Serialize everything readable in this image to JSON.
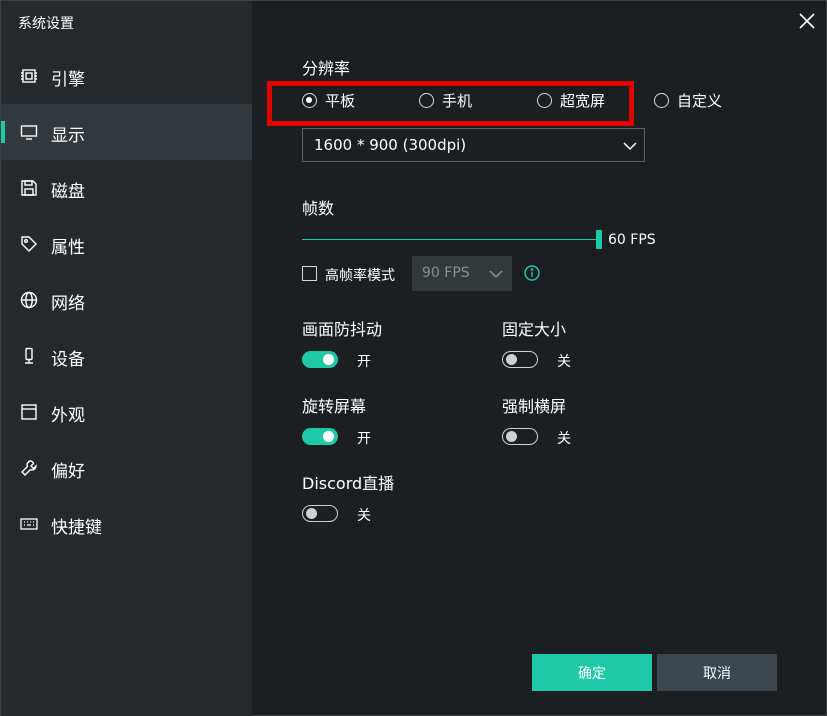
{
  "window": {
    "title": "系统设置"
  },
  "sidebar": {
    "items": [
      {
        "label": "引擎",
        "icon": "chip-icon"
      },
      {
        "label": "显示",
        "icon": "monitor-icon",
        "active": true
      },
      {
        "label": "磁盘",
        "icon": "save-disk-icon"
      },
      {
        "label": "属性",
        "icon": "tag-icon"
      },
      {
        "label": "网络",
        "icon": "globe-icon"
      },
      {
        "label": "设备",
        "icon": "device-icon"
      },
      {
        "label": "外观",
        "icon": "window-icon"
      },
      {
        "label": "偏好",
        "icon": "wrench-icon"
      },
      {
        "label": "快捷键",
        "icon": "keyboard-icon"
      }
    ]
  },
  "resolution": {
    "title": "分辨率",
    "options": [
      {
        "label": "平板",
        "checked": true
      },
      {
        "label": "手机",
        "checked": false
      },
      {
        "label": "超宽屏",
        "checked": false
      },
      {
        "label": "自定义",
        "checked": false
      }
    ],
    "selected": "1600 * 900 (300dpi)"
  },
  "fps": {
    "title": "帧数",
    "value_label": "60 FPS",
    "high_fps_label": "高帧率模式",
    "high_fps_checked": false,
    "high_fps_select": "90 FPS"
  },
  "toggles": {
    "anti_shake": {
      "title": "画面防抖动",
      "state": "开",
      "on": true
    },
    "fixed_size": {
      "title": "固定大小",
      "state": "关",
      "on": false
    },
    "rotate_screen": {
      "title": "旋转屏幕",
      "state": "开",
      "on": true
    },
    "force_landscape": {
      "title": "强制横屏",
      "state": "关",
      "on": false
    },
    "discord_live": {
      "title": "Discord直播",
      "state": "关",
      "on": false
    }
  },
  "buttons": {
    "confirm": "确定",
    "cancel": "取消"
  },
  "colors": {
    "accent": "#1fc9a6",
    "highlight": "#e00000",
    "background": "#1b1f22",
    "sidebar": "#25292c"
  }
}
